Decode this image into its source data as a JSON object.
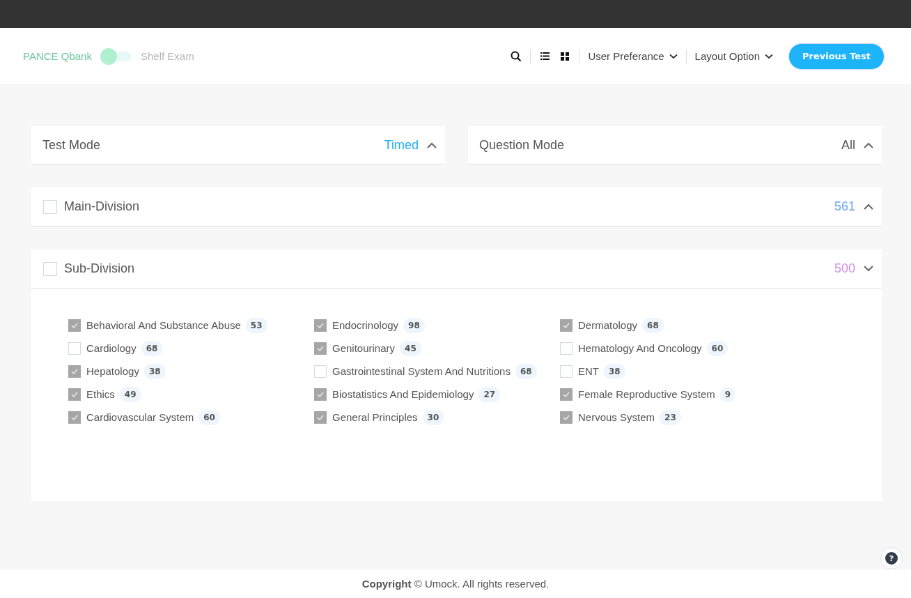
{
  "header": {
    "mode_toggle": {
      "options": [
        {
          "label": "PANCE Qbank",
          "selected": true
        },
        {
          "label": "Shelf Exam",
          "selected": false
        }
      ]
    },
    "view_buttons": [
      {
        "kind": "list",
        "selected": false
      },
      {
        "kind": "grid",
        "selected": false
      }
    ],
    "menus": [
      {
        "label": "User Preferance"
      },
      {
        "label": "Layout Option"
      }
    ],
    "primary_button": "Previous Test"
  },
  "mode_panels": [
    {
      "title": "Test Mode",
      "value": "Timed",
      "color": "#1eaef5",
      "expanded": false
    },
    {
      "title": "Question Mode",
      "value": "All",
      "color": "#555555",
      "expanded": false
    }
  ],
  "divisions": [
    {
      "title": "Main-Division",
      "checked": false,
      "count": "561",
      "color": "#6aa3ea",
      "expanded": false
    },
    {
      "title": "Sub-Division",
      "checked": false,
      "count": "500",
      "color": "#cf8ee6",
      "expanded": true,
      "columns": [
        [
          {
            "label": "Behavioral And Substance Abuse",
            "count": "53",
            "checked": true
          },
          {
            "label": "Cardiology",
            "count": "68",
            "checked": false
          },
          {
            "label": "Hepatology",
            "count": "38",
            "checked": true
          },
          {
            "label": "Ethics",
            "count": "49",
            "checked": true
          },
          {
            "label": "Cardiovascular System",
            "count": "60",
            "checked": true
          }
        ],
        [
          {
            "label": "Endocrinology",
            "count": "98",
            "checked": true
          },
          {
            "label": "Genitourinary",
            "count": "45",
            "checked": true
          },
          {
            "label": "Gastrointestinal System And Nutritions",
            "count": "68",
            "checked": false
          },
          {
            "label": "Biostatistics And Epidemiology",
            "count": "27",
            "checked": true
          },
          {
            "label": "General Principles",
            "count": "30",
            "checked": true
          }
        ],
        [
          {
            "label": "Dermatology",
            "count": "68",
            "checked": true
          },
          {
            "label": "Hematology And Oncology",
            "count": "60",
            "checked": false
          },
          {
            "label": "ENT",
            "count": "38",
            "checked": false
          },
          {
            "label": "Female Reproductive System",
            "count": "9",
            "checked": true
          },
          {
            "label": "Nervous System",
            "count": "23",
            "checked": true
          }
        ]
      ]
    }
  ],
  "help_button": "?",
  "footer": "**Copyright** © Umock. All rights reserved."
}
